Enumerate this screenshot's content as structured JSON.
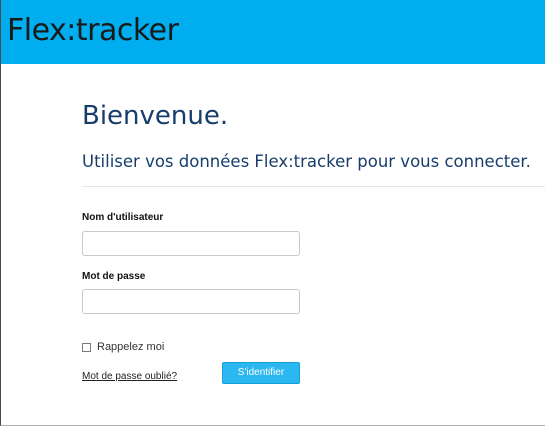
{
  "header": {
    "brand": "Flex:tracker"
  },
  "welcome": {
    "title": "Bienvenue.",
    "subtitle": "Utiliser vos données Flex:tracker pour vous connecter."
  },
  "form": {
    "username": {
      "label": "Nom d'utilisateur",
      "value": ""
    },
    "password": {
      "label": "Mot de passe",
      "value": ""
    },
    "remember_me": {
      "label": "Rappelez moi",
      "checked": false
    },
    "forgot_password_link": "Mot de passe oublié?",
    "submit_label": "S'identifier"
  },
  "colors": {
    "header_background": "#00aeef",
    "title_text": "#173d6b",
    "button_background": "#2bb7ef"
  }
}
